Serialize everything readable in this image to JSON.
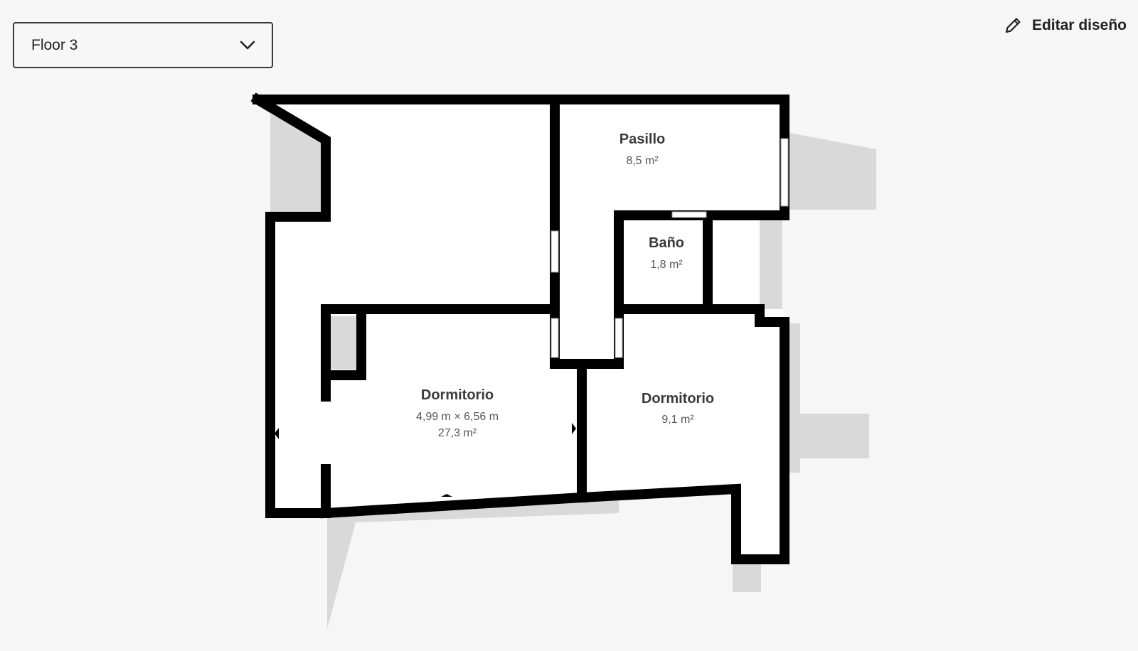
{
  "floor_selector": {
    "selected": "Floor 3",
    "icon": "chevron-down-icon"
  },
  "edit_button": {
    "label": "Editar diseño",
    "icon": "pencil-icon"
  },
  "rooms": [
    {
      "name": "Pasillo",
      "area": "8,5 m²"
    },
    {
      "name": "Baño",
      "area": "1,8 m²"
    },
    {
      "name": "Dormitorio",
      "dimensions": "4,99 m × 6,56 m",
      "area": "27,3 m²"
    },
    {
      "name": "Dormitorio",
      "area": "9,1 m²"
    }
  ],
  "colors": {
    "background": "#f6f6f6",
    "wall": "#000000",
    "floor": "#ffffff",
    "shadow": "#d9d9d9"
  }
}
